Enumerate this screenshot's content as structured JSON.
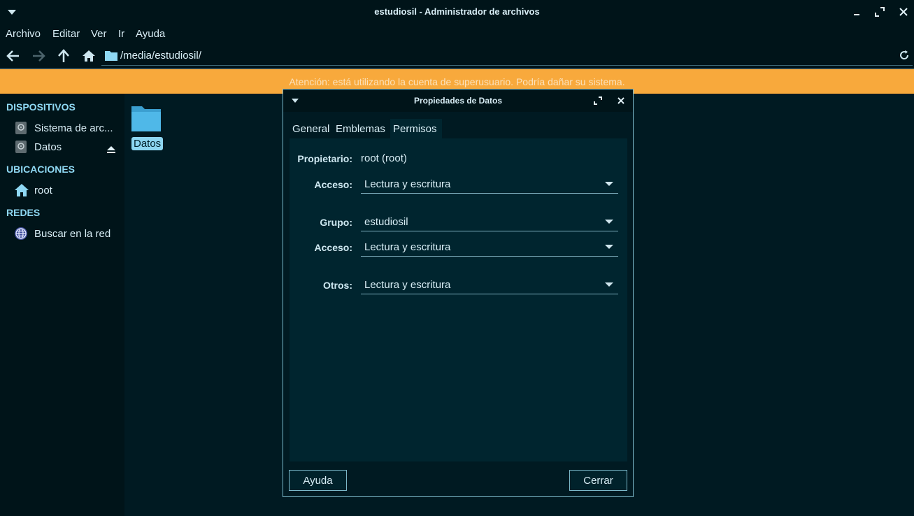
{
  "window": {
    "title": "estudiosil - Administrador de archivos"
  },
  "menubar": {
    "items": [
      "Archivo",
      "Editar",
      "Ver",
      "Ir",
      "Ayuda"
    ]
  },
  "toolbar": {
    "path": "/media/estudiosil/"
  },
  "warning": {
    "text": "Atención: está utilizando la cuenta de superusuario. Podría dañar su sistema."
  },
  "sidebar": {
    "devices_title": "DISPOSITIVOS",
    "devices": [
      "Sistema de arc...",
      "Datos"
    ],
    "places_title": "UBICACIONES",
    "places": [
      "root"
    ],
    "network_title": "REDES",
    "network": [
      "Buscar en la red"
    ]
  },
  "files": [
    {
      "name": "Datos"
    }
  ],
  "dialog": {
    "title": "Propiedades de Datos",
    "tabs": [
      "General",
      "Emblemas",
      "Permisos"
    ],
    "owner_label": "Propietario:",
    "owner_value": "root (root)",
    "owner_access_label": "Acceso:",
    "owner_access_value": "Lectura y escritura",
    "group_label": "Grupo:",
    "group_value": "estudiosil",
    "group_access_label": "Acceso:",
    "group_access_value": "Lectura y escritura",
    "others_label": "Otros:",
    "others_value": "Lectura y escritura",
    "help_button": "Ayuda",
    "close_button": "Cerrar"
  },
  "colors": {
    "accent": "#8fd9f4",
    "warning": "#f8a93c",
    "background": "#001a22",
    "panel": "#00252f"
  }
}
